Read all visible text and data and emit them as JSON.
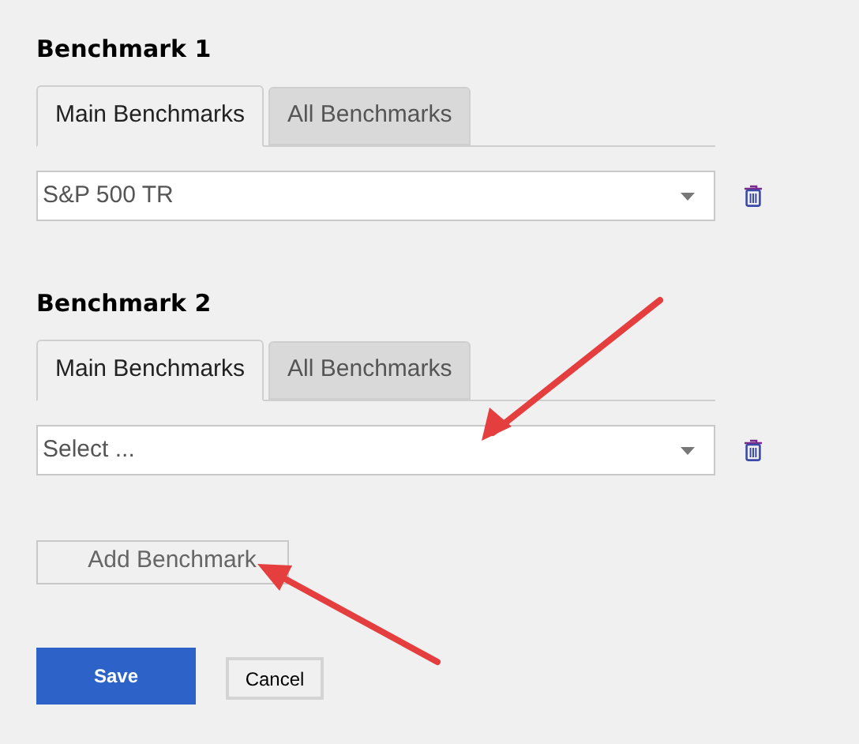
{
  "benchmarks": [
    {
      "title": "Benchmark 1",
      "tabs": [
        {
          "label": "Main Benchmarks",
          "selected": true
        },
        {
          "label": "All Benchmarks",
          "selected": false
        }
      ],
      "select": {
        "value": "S&P 500 TR"
      }
    },
    {
      "title": "Benchmark 2",
      "tabs": [
        {
          "label": "Main Benchmarks",
          "selected": true
        },
        {
          "label": "All Benchmarks",
          "selected": false
        }
      ],
      "select": {
        "placeholder": "Select ..."
      }
    }
  ],
  "add_button": "Add Benchmark",
  "buttons": [
    {
      "label": "Save",
      "kind": "primary"
    },
    {
      "label": "Cancel",
      "kind": "secondary"
    }
  ]
}
